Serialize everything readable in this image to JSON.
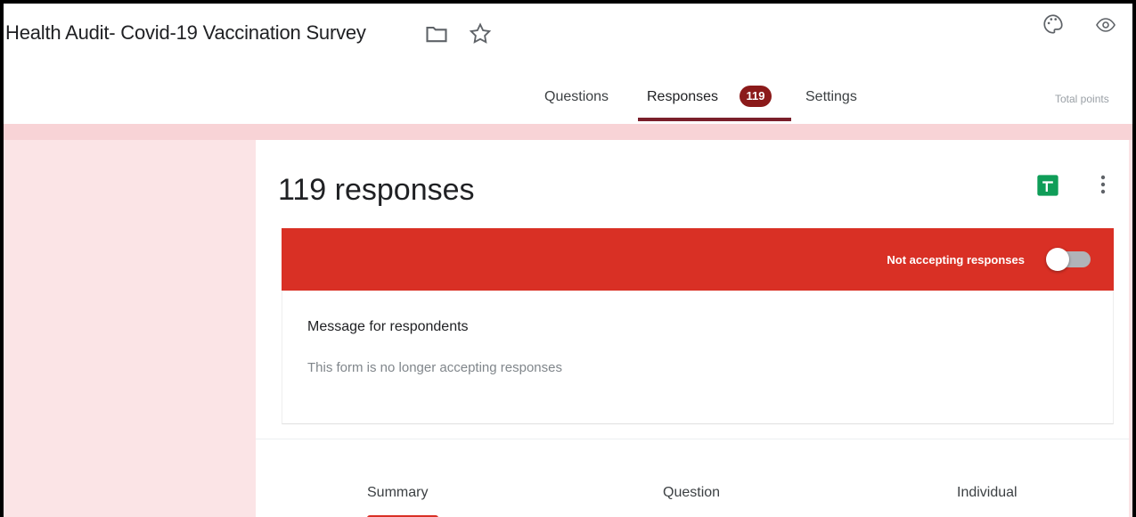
{
  "header": {
    "title": "Health Audit- Covid-19 Vaccination Survey",
    "tabs": [
      {
        "label": "Questions"
      },
      {
        "label": "Responses",
        "badge": "119"
      },
      {
        "label": "Settings"
      }
    ],
    "total_points": "Total points"
  },
  "icons": {
    "folder": "folder-icon",
    "star": "star-icon",
    "palette": "palette-icon",
    "preview": "eye-icon",
    "sheets": "sheets-icon",
    "more": "more-vert-icon"
  },
  "card": {
    "responses_title": "119 responses",
    "banner": {
      "text": "Not accepting responses",
      "color": "#d93025",
      "toggle_on": false
    },
    "message": {
      "label": "Message for respondents",
      "value": "This form is no longer accepting responses"
    },
    "subtabs": [
      {
        "label": "Summary"
      },
      {
        "label": "Question"
      },
      {
        "label": "Individual"
      }
    ]
  },
  "colors": {
    "accent": "#7a1f2b",
    "banner": "#d93025",
    "background": "#fbe4e6"
  }
}
